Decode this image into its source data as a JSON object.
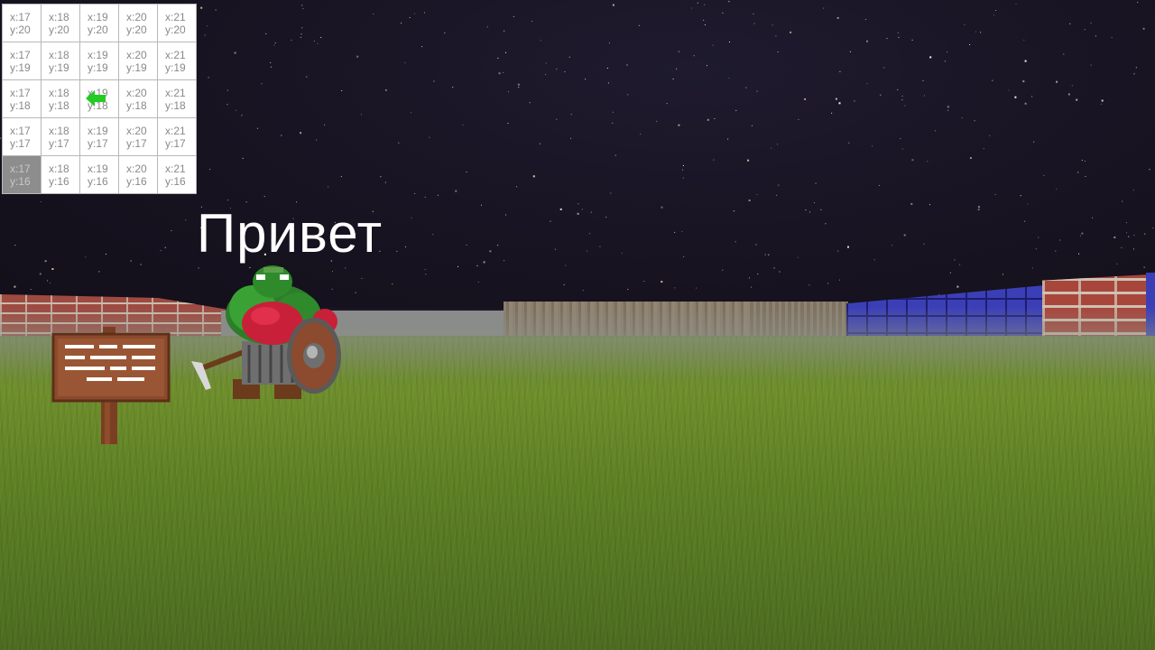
{
  "speech_text": "Привет",
  "minimap": {
    "rows": [
      {
        "cells": [
          {
            "x": "x:17",
            "y": "y:20"
          },
          {
            "x": "x:18",
            "y": "y:20"
          },
          {
            "x": "x:19",
            "y": "y:20"
          },
          {
            "x": "x:20",
            "y": "y:20"
          },
          {
            "x": "x:21",
            "y": "y:20"
          }
        ]
      },
      {
        "cells": [
          {
            "x": "x:17",
            "y": "y:19"
          },
          {
            "x": "x:18",
            "y": "y:19"
          },
          {
            "x": "x:19",
            "y": "y:19"
          },
          {
            "x": "x:20",
            "y": "y:19"
          },
          {
            "x": "x:21",
            "y": "y:19"
          }
        ]
      },
      {
        "cells": [
          {
            "x": "x:17",
            "y": "y:18"
          },
          {
            "x": "x:18",
            "y": "y:18"
          },
          {
            "x": "x:19",
            "y": "y:18"
          },
          {
            "x": "x:20",
            "y": "y:18"
          },
          {
            "x": "x:21",
            "y": "y:18"
          }
        ]
      },
      {
        "cells": [
          {
            "x": "x:17",
            "y": "y:17"
          },
          {
            "x": "x:18",
            "y": "y:17"
          },
          {
            "x": "x:19",
            "y": "y:17"
          },
          {
            "x": "x:20",
            "y": "y:17"
          },
          {
            "x": "x:21",
            "y": "y:17"
          }
        ]
      },
      {
        "cells": [
          {
            "x": "x:17",
            "y": "y:16"
          },
          {
            "x": "x:18",
            "y": "y:16"
          },
          {
            "x": "x:19",
            "y": "y:16"
          },
          {
            "x": "x:20",
            "y": "y:16"
          },
          {
            "x": "x:21",
            "y": "y:16"
          }
        ]
      }
    ],
    "player_cell": "x:19 y:18",
    "player_direction": "left",
    "blocked_cell": "x:17 y:16"
  },
  "colors": {
    "player_arrow": "#22cc22",
    "sky": "#16121f",
    "grass": "#5d7f24"
  },
  "icons": {
    "player": "player-arrow-icon",
    "sign": "wooden-sign-icon",
    "npc": "orc-npc-icon"
  }
}
